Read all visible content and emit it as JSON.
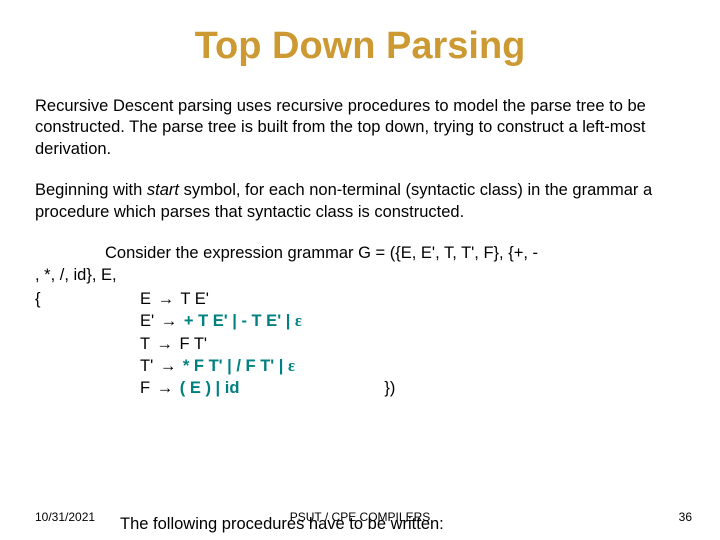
{
  "title": "Top Down Parsing",
  "para1": "Recursive Descent parsing uses recursive procedures to model the parse tree to be constructed. The parse tree is built from the top down, trying to construct a left-most derivation.",
  "para2a": "Beginning with ",
  "para2_start": "start",
  "para2b": " symbol, for each non-terminal (syntactic class) in the grammar a procedure which parses that syntactic class is constructed.",
  "grammar_intro_indent": "Consider the expression grammar G = ({E, E', T, T', F}, {+, -",
  "grammar_intro_cont": ", *, /, id}, E,",
  "brace_open": "{",
  "rules": [
    {
      "lhs": "E",
      "arrow": "→",
      "rhs_plain": "T E'",
      "rhs_teal": "",
      "eps": ""
    },
    {
      "lhs": "E'",
      "arrow": "→",
      "rhs_teal": "+ T E' | - T E' | ",
      "eps": "ε"
    },
    {
      "lhs": "T",
      "arrow": "→",
      "rhs_plain": "F T'",
      "rhs_teal": "",
      "eps": ""
    },
    {
      "lhs": "T'",
      "arrow": "→",
      "rhs_teal": "* F T' | / F T' | ",
      "eps": "ε"
    },
    {
      "lhs": "F",
      "arrow": "→",
      "rhs_teal": "( E ) | id",
      "eps": "",
      "close": "})"
    }
  ],
  "closing": "The following procedures have to be written:",
  "footer": {
    "date": "10/31/2021",
    "center": "PSUT / CPE COMPILERS",
    "page": "36"
  }
}
